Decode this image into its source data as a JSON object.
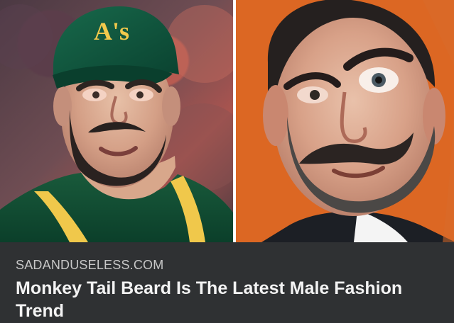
{
  "article": {
    "source": "SADANDUSELESS.COM",
    "headline": "Monkey Tail Beard Is The Latest Male Fashion Trend"
  },
  "images": [
    {
      "name": "left-photo",
      "description": "Athlete wearing a green baseball cap and jersey"
    },
    {
      "name": "right-photo",
      "description": "Man with bushy eyebrow and curled mustache"
    }
  ],
  "colors": {
    "background": "#2f3133",
    "source_text": "#c7c7c7",
    "headline_text": "#f3f3f3",
    "cap_green": "#0f5a3b",
    "cap_logo": "#f2c94c",
    "jersey_gold": "#f0c84b",
    "right_bg": "#e36e25"
  }
}
